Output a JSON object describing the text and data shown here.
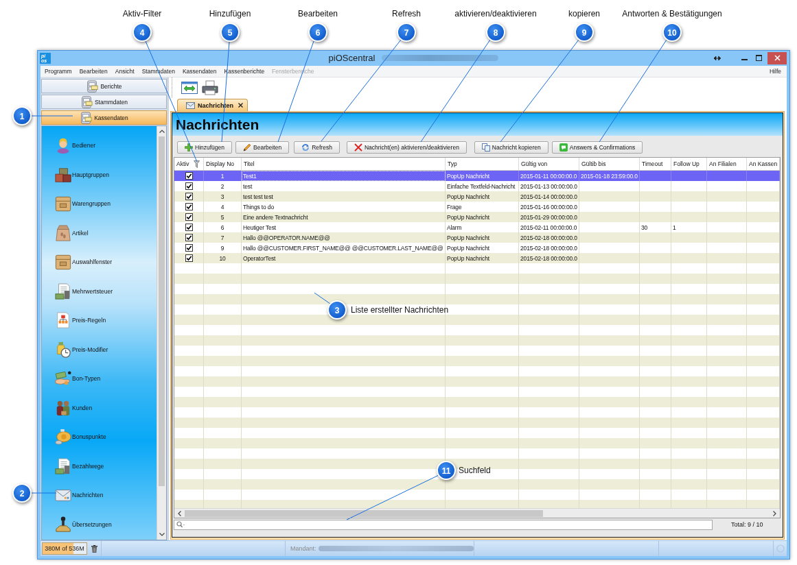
{
  "callouts": [
    {
      "number": "1"
    },
    {
      "number": "2"
    },
    {
      "number": "3",
      "label": "Liste erstellter Nachrichten"
    },
    {
      "number": "4",
      "label": "Aktiv-Filter"
    },
    {
      "number": "5",
      "label": "Hinzufügen"
    },
    {
      "number": "6",
      "label": "Bearbeiten"
    },
    {
      "number": "7",
      "label": "Refresh"
    },
    {
      "number": "8",
      "label": "aktivieren/deaktivieren"
    },
    {
      "number": "9",
      "label": "kopieren"
    },
    {
      "number": "10",
      "label": "Antworten & Bestätigungen"
    },
    {
      "number": "11",
      "label": "Suchfeld"
    }
  ],
  "window": {
    "logo": [
      "pi",
      "os"
    ],
    "title": "piOScentral"
  },
  "menu": {
    "items": [
      {
        "label": "Programm",
        "disabled": false
      },
      {
        "label": "Bearbeiten",
        "disabled": false
      },
      {
        "label": "Ansicht",
        "disabled": false
      },
      {
        "label": "Stammdaten",
        "disabled": false
      },
      {
        "label": "Kassendaten",
        "disabled": false
      },
      {
        "label": "Kassenberichte",
        "disabled": false
      },
      {
        "label": "Fensterbereiche",
        "disabled": true
      }
    ],
    "help": "Hilfe"
  },
  "sidebar": {
    "sections": [
      {
        "label": "Berichte",
        "selected": false
      },
      {
        "label": "Stammdaten",
        "selected": false
      },
      {
        "label": "Kassendaten",
        "selected": true
      }
    ],
    "items": [
      {
        "label": "Bediener",
        "selected": false
      },
      {
        "label": "Hauptgruppen",
        "selected": false
      },
      {
        "label": "Warengruppen",
        "selected": false
      },
      {
        "label": "Artikel",
        "selected": false
      },
      {
        "label": "Auswahlfenster",
        "selected": false
      },
      {
        "label": "Mehrwertsteuer",
        "selected": false
      },
      {
        "label": "Preis-Regeln",
        "selected": false
      },
      {
        "label": "Preis-Modifier",
        "selected": false
      },
      {
        "label": "Bon-Typen",
        "selected": false
      },
      {
        "label": "Kunden",
        "selected": false
      },
      {
        "label": "Bonuspunkte",
        "selected": false
      },
      {
        "label": "Bezahlwege",
        "selected": false
      },
      {
        "label": "Nachrichten",
        "selected": false
      },
      {
        "label": "Übersetzungen",
        "selected": false
      }
    ]
  },
  "tabs": [
    {
      "label": "Nachrichten",
      "selected": true
    }
  ],
  "panel": {
    "title": "Nachrichten",
    "buttons": [
      "Hinzufügen",
      "Bearbeiten",
      "Refresh",
      "Nachricht(en) aktivieren/deaktivieren",
      "Nachricht kopieren",
      "Answers & Confirmations"
    ]
  },
  "table": {
    "columns": [
      "Aktiv",
      "Display No",
      "Titel",
      "Typ",
      "Gültig von",
      "Gültib bis",
      "Timeout",
      "Follow Up",
      "An Filialen",
      "An Kassen"
    ],
    "rows": [
      {
        "selected": true,
        "checked": true,
        "cells": [
          null,
          "1",
          "Test1",
          "PopUp Nachricht",
          "2015-01-11 00:00:00.0",
          "2015-01-18 23:59:00.0"
        ]
      },
      {
        "selected": false,
        "checked": true,
        "cells": [
          null,
          "2",
          "test",
          "Einfache Textfeld-Nachricht",
          "2015-01-13 00:00:00.0"
        ]
      },
      {
        "selected": false,
        "checked": true,
        "cells": [
          null,
          "3",
          "test test test",
          "PopUp Nachricht",
          "2015-01-14 00:00:00.0"
        ]
      },
      {
        "selected": false,
        "checked": true,
        "cells": [
          null,
          "4",
          "Things to do",
          "Frage",
          "2015-01-16 00:00:00.0"
        ]
      },
      {
        "selected": false,
        "checked": true,
        "cells": [
          null,
          "5",
          "Eine andere Textnachricht",
          "PopUp Nachricht",
          "2015-01-29 00:00:00.0"
        ]
      },
      {
        "selected": false,
        "checked": true,
        "cells": [
          null,
          "6",
          "Heutiger Test",
          "Alarm",
          "2015-02-11 00:00:00.0",
          null,
          "30",
          "1"
        ]
      },
      {
        "selected": false,
        "checked": true,
        "cells": [
          null,
          "7",
          "Hallo @@OPERATOR.NAME@@",
          "PopUp Nachricht",
          "2015-02-18 00:00:00.0"
        ]
      },
      {
        "selected": false,
        "checked": true,
        "cells": [
          null,
          "9",
          "Hallo @@CUSTOMER.FIRST_NAME@@ @@CUSTOMER.LAST_NAME@@",
          "PopUp Nachricht",
          "2015-02-18 00:00:00.0"
        ]
      },
      {
        "selected": false,
        "checked": true,
        "cells": [
          null,
          "10",
          "OperatorTest",
          "PopUp Nachricht",
          "2015-02-18 00:00:00.0"
        ]
      }
    ]
  },
  "search": {
    "total": "Total: 9 / 10"
  },
  "status_bar": {
    "memory": {
      "reading": "380M of 536M",
      "level": 0.71
    },
    "mandant_label": "Mandant:"
  }
}
